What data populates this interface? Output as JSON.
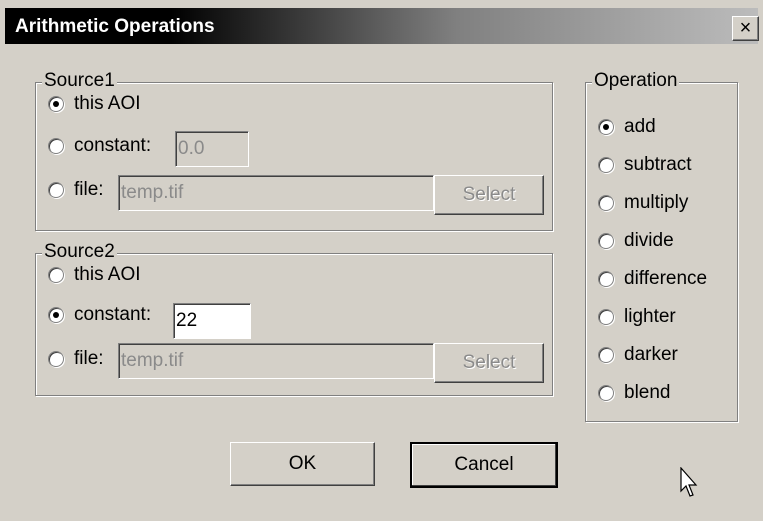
{
  "window": {
    "title": "Arithmetic Operations",
    "close_glyph": "×"
  },
  "source1": {
    "legend": "Source1",
    "options": [
      {
        "label": "this AOI",
        "selected": true
      },
      {
        "label": "constant:",
        "selected": false
      },
      {
        "label": "file:",
        "selected": false
      }
    ],
    "constant_value": "0.0",
    "file_value": "temp.tif",
    "select_label": "Select"
  },
  "source2": {
    "legend": "Source2",
    "options": [
      {
        "label": "this AOI",
        "selected": false
      },
      {
        "label": "constant:",
        "selected": true
      },
      {
        "label": "file:",
        "selected": false
      }
    ],
    "constant_value": "22",
    "file_value": "temp.tif",
    "select_label": "Select"
  },
  "operation": {
    "legend": "Operation",
    "options": [
      {
        "label": "add",
        "selected": true
      },
      {
        "label": "subtract",
        "selected": false
      },
      {
        "label": "multiply",
        "selected": false
      },
      {
        "label": "divide",
        "selected": false
      },
      {
        "label": "difference",
        "selected": false
      },
      {
        "label": "lighter",
        "selected": false
      },
      {
        "label": "darker",
        "selected": false
      },
      {
        "label": "blend",
        "selected": false
      }
    ]
  },
  "buttons": {
    "ok": "OK",
    "cancel": "Cancel"
  },
  "icons": {
    "close": "close-icon",
    "cursor": "mouse-pointer-icon"
  },
  "colors": {
    "face": "#d4d0c8",
    "title_start": "#000000",
    "title_end": "#bcbcbc",
    "disabled_text": "#8a8a8a"
  }
}
